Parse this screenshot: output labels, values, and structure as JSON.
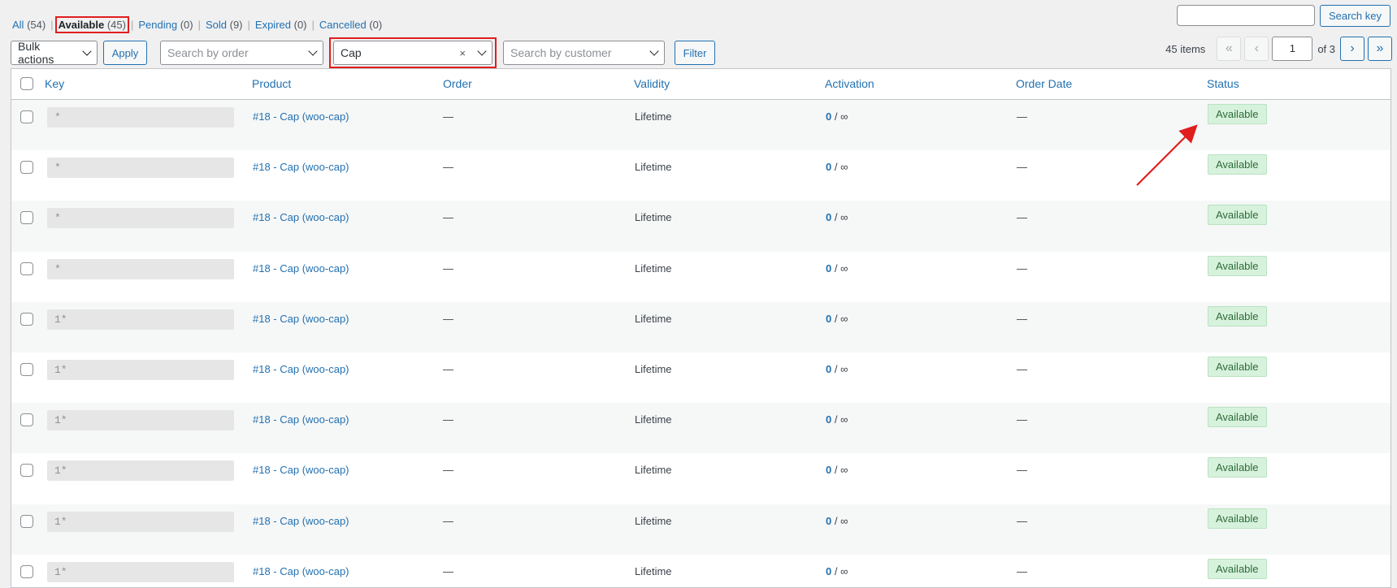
{
  "status_filters": [
    {
      "label": "All",
      "count": "(54)",
      "current": false
    },
    {
      "label": "Available",
      "count": "(45)",
      "current": true
    },
    {
      "label": "Pending",
      "count": "(0)",
      "current": false
    },
    {
      "label": "Sold",
      "count": "(9)",
      "current": false
    },
    {
      "label": "Expired",
      "count": "(0)",
      "current": false
    },
    {
      "label": "Cancelled",
      "count": "(0)",
      "current": false
    }
  ],
  "search": {
    "value": "",
    "button_label": "Search key"
  },
  "toolbar": {
    "bulk_actions_label": "Bulk actions",
    "apply_label": "Apply",
    "order_placeholder": "Search by order",
    "product_value": "Cap",
    "product_clear": "×",
    "customer_placeholder": "Search by customer",
    "filter_label": "Filter"
  },
  "pagination": {
    "items_text": "45 items",
    "first": "«",
    "prev": "‹",
    "current_page": "1",
    "of_text": "of 3",
    "next": "›",
    "last": "»"
  },
  "table": {
    "columns": [
      "Key",
      "Product",
      "Order",
      "Validity",
      "Activation",
      "Order Date",
      "Status"
    ],
    "rows": [
      {
        "key": "*",
        "product": "#18 - Cap (woo-cap)",
        "order": "—",
        "validity": "Lifetime",
        "activation_count": "0",
        "activation_max": " / ∞",
        "order_date": "—",
        "status": "Available"
      },
      {
        "key": "*",
        "product": "#18 - Cap (woo-cap)",
        "order": "—",
        "validity": "Lifetime",
        "activation_count": "0",
        "activation_max": " / ∞",
        "order_date": "—",
        "status": "Available"
      },
      {
        "key": "*",
        "product": "#18 - Cap (woo-cap)",
        "order": "—",
        "validity": "Lifetime",
        "activation_count": "0",
        "activation_max": " / ∞",
        "order_date": "—",
        "status": "Available"
      },
      {
        "key": "*",
        "product": "#18 - Cap (woo-cap)",
        "order": "—",
        "validity": "Lifetime",
        "activation_count": "0",
        "activation_max": " / ∞",
        "order_date": "—",
        "status": "Available"
      },
      {
        "key": "1*",
        "product": "#18 - Cap (woo-cap)",
        "order": "—",
        "validity": "Lifetime",
        "activation_count": "0",
        "activation_max": " / ∞",
        "order_date": "—",
        "status": "Available"
      },
      {
        "key": "1*",
        "product": "#18 - Cap (woo-cap)",
        "order": "—",
        "validity": "Lifetime",
        "activation_count": "0",
        "activation_max": " / ∞",
        "order_date": "—",
        "status": "Available"
      },
      {
        "key": "1*",
        "product": "#18 - Cap (woo-cap)",
        "order": "—",
        "validity": "Lifetime",
        "activation_count": "0",
        "activation_max": " / ∞",
        "order_date": "—",
        "status": "Available"
      },
      {
        "key": "1*",
        "product": "#18 - Cap (woo-cap)",
        "order": "—",
        "validity": "Lifetime",
        "activation_count": "0",
        "activation_max": " / ∞",
        "order_date": "—",
        "status": "Available"
      },
      {
        "key": "1*",
        "product": "#18 - Cap (woo-cap)",
        "order": "—",
        "validity": "Lifetime",
        "activation_count": "0",
        "activation_max": " / ∞",
        "order_date": "—",
        "status": "Available"
      },
      {
        "key": "1*",
        "product": "#18 - Cap (woo-cap)",
        "order": "—",
        "validity": "Lifetime",
        "activation_count": "0",
        "activation_max": " / ∞",
        "order_date": "—",
        "status": "Available"
      }
    ]
  },
  "colors": {
    "link": "#2271b1",
    "annotation_red": "#e01e1e",
    "badge_bg": "#d7f2dc",
    "badge_text": "#2e6b3a"
  }
}
